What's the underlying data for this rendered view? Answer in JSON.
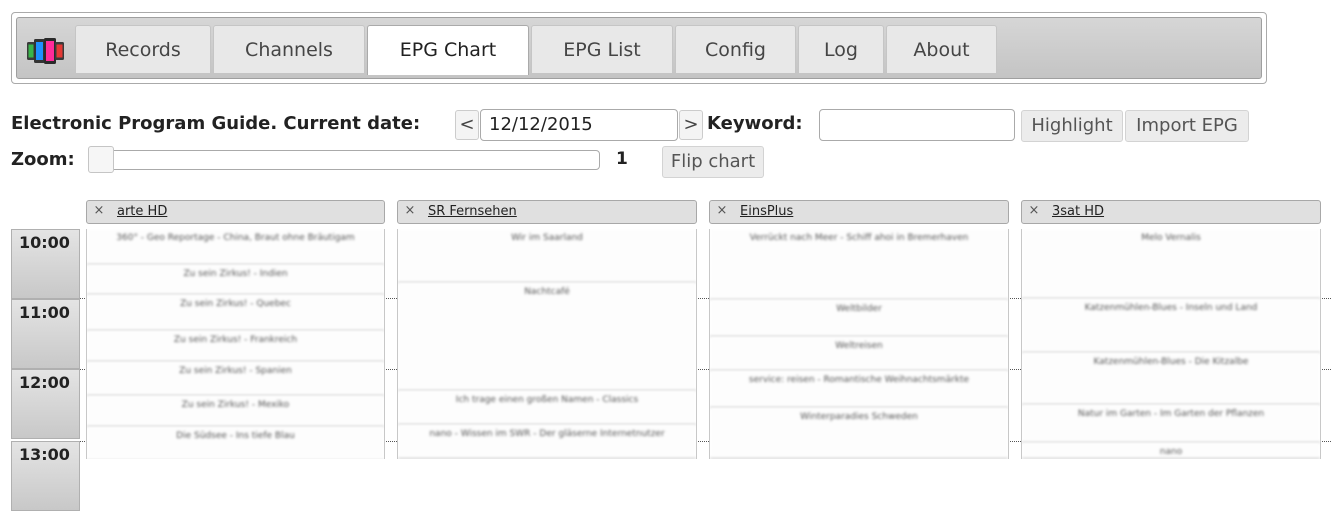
{
  "tabs": [
    {
      "label": "Records"
    },
    {
      "label": "Channels"
    },
    {
      "label": "EPG Chart"
    },
    {
      "label": "EPG List"
    },
    {
      "label": "Config"
    },
    {
      "label": "Log"
    },
    {
      "label": "About"
    }
  ],
  "toolbar": {
    "title_label": "Electronic Program Guide. Current date:",
    "prev_label": "<",
    "date_value": "12/12/2015",
    "next_label": ">",
    "keyword_label": "Keyword:",
    "keyword_value": "",
    "highlight_label": "Highlight",
    "import_label": "Import EPG",
    "zoom_label": "Zoom:",
    "zoom_value": "1",
    "flip_label": "Flip chart"
  },
  "times": [
    "10:00",
    "11:00",
    "12:00",
    "13:00"
  ],
  "channels": [
    {
      "name": "arte HD",
      "close": "×",
      "programs": [
        {
          "title": "360° - Geo Reportage - China, Braut ohne Bräutigam"
        },
        {
          "title": "Zu sein Zirkus! - Indien"
        },
        {
          "title": "Zu sein Zirkus! - Quebec"
        },
        {
          "title": "Zu sein Zirkus! - Frankreich"
        },
        {
          "title": "Zu sein Zirkus! - Spanien"
        },
        {
          "title": "Zu sein Zirkus! - Mexiko"
        },
        {
          "title": "Die Südsee - Ins tiefe Blau"
        }
      ]
    },
    {
      "name": "SR Fernsehen",
      "close": "×",
      "programs": [
        {
          "title": "Wir im Saarland"
        },
        {
          "title": "Nachtcafé"
        },
        {
          "title": "Ich trage einen großen Namen - Classics"
        },
        {
          "title": "nano - Wissen im SWR - Der gläserne Internetnutzer"
        }
      ]
    },
    {
      "name": "EinsPlus",
      "close": "×",
      "programs": [
        {
          "title": "Verrückt nach Meer - Schiff ahoi in Bremerhaven"
        },
        {
          "title": "Weltbilder"
        },
        {
          "title": "Weltreisen"
        },
        {
          "title": "service: reisen - Romantische Weihnachtsmärkte"
        },
        {
          "title": "Winterparadies Schweden"
        }
      ]
    },
    {
      "name": "3sat HD",
      "close": "×",
      "programs": [
        {
          "title": "Melo Vernalis"
        },
        {
          "title": "Katzenmühlen-Blues - Inseln und Land"
        },
        {
          "title": "Katzenmühlen-Blues - Die Kitzalbe"
        },
        {
          "title": "Natur im Garten - Im Garten der Pflanzen"
        },
        {
          "title": "nano"
        }
      ]
    }
  ]
}
